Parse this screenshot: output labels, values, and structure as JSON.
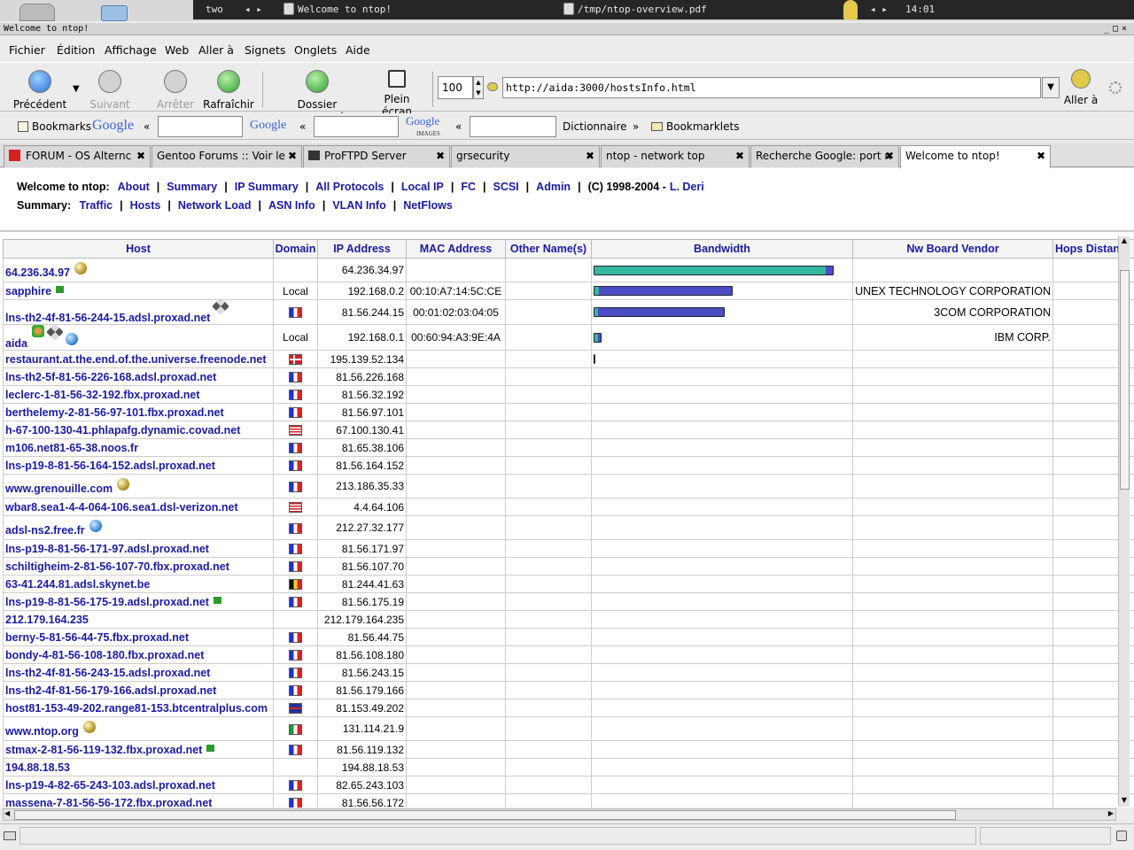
{
  "taskbar": {
    "desktop": "two",
    "arrows": "◂  ▸",
    "task1": "Welcome to ntop!",
    "task2": "/tmp/ntop-overview.pdf",
    "clock_arrows": "◂  ▸",
    "clock": "14:01"
  },
  "window": {
    "title": "Welcome to ntop!",
    "buttons": "_□×"
  },
  "menu": [
    "Fichier",
    "Édition",
    "Affichage",
    "Web",
    "Aller à",
    "Signets",
    "Onglets",
    "Aide"
  ],
  "toolbar": {
    "back": "Précédent",
    "forward": "Suivant",
    "stop": "Arrêter",
    "reload": "Rafraîchir",
    "home": "Dossier personnel",
    "fullscreen": "Plein écran",
    "zoom": "100",
    "url": "http://aida:3000/hostsInfo.html",
    "go": "Aller à"
  },
  "bookmarks_bar": {
    "bookmarks": "Bookmarks",
    "google": "Google",
    "google2": "Google",
    "google_images": "Google",
    "images_sub": "IMAGES",
    "quote": "«",
    "dictionary": "Dictionnaire",
    "dict_sep": "»",
    "bookmarklets": "Bookmarklets"
  },
  "tabs": [
    {
      "label": "FORUM - OS Alternc",
      "close": "✖"
    },
    {
      "label": "Gentoo Forums :: Voir le",
      "close": "✖"
    },
    {
      "label": "ProFTPD Server",
      "close": "✖"
    },
    {
      "label": "grsecurity",
      "close": "✖"
    },
    {
      "label": "ntop - network top",
      "close": "✖"
    },
    {
      "label": "Recherche Google: port n",
      "close": "✖"
    },
    {
      "label": "Welcome to ntop!",
      "close": "✖"
    }
  ],
  "pagenav": {
    "welcome": "Welcome to ntop:",
    "links1": [
      "About",
      "Summary",
      "IP Summary",
      "All Protocols",
      "Local IP",
      "FC",
      "SCSI",
      "Admin"
    ],
    "copyright": "(C) 1998-2004 -",
    "author": "L. Deri",
    "summary": "Summary:",
    "links2": [
      "Traffic",
      "Hosts",
      "Network Load",
      "ASN Info",
      "VLAN Info",
      "NetFlows"
    ]
  },
  "table": {
    "headers": [
      "Host",
      "Domain",
      "IP Address",
      "MAC Address",
      "Other Name(s)",
      "Bandwidth",
      "Nw Board Vendor",
      "Hops Distan"
    ],
    "rows": [
      {
        "host": "64.236.34.97",
        "domain": "",
        "ip": "64.236.34.97",
        "mac": "",
        "vendor": "",
        "bw": 0.95,
        "icon": "gold",
        "tall": true
      },
      {
        "host": "sapphire",
        "domain": "Local",
        "ip": "192.168.0.2",
        "mac": "00:10:A7:14:5C:CE",
        "vendor": "UNEX TECHNOLOGY CORPORATION",
        "bw": 0.55,
        "icon": "flag"
      },
      {
        "host": "lns-th2-4f-81-56-244-15.adsl.proxad.net",
        "domain": "fr",
        "ip": "81.56.244.15",
        "mac": "00:01:02:03:04:05",
        "vendor": "3COM CORPORATION",
        "bw": 0.52,
        "icon": "arrows",
        "tall": true
      },
      {
        "host": "aida",
        "domain": "Local",
        "ip": "192.168.0.1",
        "mac": "00:60:94:A3:9E:4A",
        "vendor": "IBM CORP.",
        "bw": 0.03,
        "icon": "multi",
        "tall": true
      },
      {
        "host": "restaurant.at.the.end.of.the.universe.freenode.net",
        "domain": "no",
        "ip": "195.139.52.134",
        "mac": "",
        "vendor": "",
        "bw": 0.01
      },
      {
        "host": "lns-th2-5f-81-56-226-168.adsl.proxad.net",
        "domain": "fr",
        "ip": "81.56.226.168",
        "mac": "",
        "vendor": "",
        "bw": 0
      },
      {
        "host": "leclerc-1-81-56-32-192.fbx.proxad.net",
        "domain": "fr",
        "ip": "81.56.32.192",
        "mac": "",
        "vendor": "",
        "bw": 0
      },
      {
        "host": "berthelemy-2-81-56-97-101.fbx.proxad.net",
        "domain": "fr",
        "ip": "81.56.97.101",
        "mac": "",
        "vendor": "",
        "bw": 0
      },
      {
        "host": "h-67-100-130-41.phlapafg.dynamic.covad.net",
        "domain": "us",
        "ip": "67.100.130.41",
        "mac": "",
        "vendor": "",
        "bw": 0
      },
      {
        "host": "m106.net81-65-38.noos.fr",
        "domain": "fr",
        "ip": "81.65.38.106",
        "mac": "",
        "vendor": "",
        "bw": 0
      },
      {
        "host": "lns-p19-8-81-56-164-152.adsl.proxad.net",
        "domain": "fr",
        "ip": "81.56.164.152",
        "mac": "",
        "vendor": "",
        "bw": 0
      },
      {
        "host": "www.grenouille.com",
        "domain": "fr",
        "ip": "213.186.35.33",
        "mac": "",
        "vendor": "",
        "bw": 0,
        "icon": "gold",
        "tall": true
      },
      {
        "host": "wbar8.sea1-4-4-064-106.sea1.dsl-verizon.net",
        "domain": "us",
        "ip": "4.4.64.106",
        "mac": "",
        "vendor": "",
        "bw": 0
      },
      {
        "host": "adsl-ns2.free.fr",
        "domain": "fr",
        "ip": "212.27.32.177",
        "mac": "",
        "vendor": "",
        "bw": 0,
        "icon": "globe",
        "tall": true
      },
      {
        "host": "lns-p19-8-81-56-171-97.adsl.proxad.net",
        "domain": "fr",
        "ip": "81.56.171.97",
        "mac": "",
        "vendor": "",
        "bw": 0
      },
      {
        "host": "schiltigheim-2-81-56-107-70.fbx.proxad.net",
        "domain": "fr",
        "ip": "81.56.107.70",
        "mac": "",
        "vendor": "",
        "bw": 0
      },
      {
        "host": "63-41.244.81.adsl.skynet.be",
        "domain": "be",
        "ip": "81.244.41.63",
        "mac": "",
        "vendor": "",
        "bw": 0
      },
      {
        "host": "lns-p19-8-81-56-175-19.adsl.proxad.net",
        "domain": "fr",
        "ip": "81.56.175.19",
        "mac": "",
        "vendor": "",
        "bw": 0,
        "icon": "flag"
      },
      {
        "host": "212.179.164.235",
        "domain": "",
        "ip": "212.179.164.235",
        "mac": "",
        "vendor": "",
        "bw": 0
      },
      {
        "host": "berny-5-81-56-44-75.fbx.proxad.net",
        "domain": "fr",
        "ip": "81.56.44.75",
        "mac": "",
        "vendor": "",
        "bw": 0
      },
      {
        "host": "bondy-4-81-56-108-180.fbx.proxad.net",
        "domain": "fr",
        "ip": "81.56.108.180",
        "mac": "",
        "vendor": "",
        "bw": 0
      },
      {
        "host": "lns-th2-4f-81-56-243-15.adsl.proxad.net",
        "domain": "fr",
        "ip": "81.56.243.15",
        "mac": "",
        "vendor": "",
        "bw": 0
      },
      {
        "host": "lns-th2-4f-81-56-179-166.adsl.proxad.net",
        "domain": "fr",
        "ip": "81.56.179.166",
        "mac": "",
        "vendor": "",
        "bw": 0
      },
      {
        "host": "host81-153-49-202.range81-153.btcentralplus.com",
        "domain": "uk",
        "ip": "81.153.49.202",
        "mac": "",
        "vendor": "",
        "bw": 0
      },
      {
        "host": "www.ntop.org",
        "domain": "it",
        "ip": "131.114.21.9",
        "mac": "",
        "vendor": "",
        "bw": 0,
        "icon": "gold",
        "tall": true
      },
      {
        "host": "stmax-2-81-56-119-132.fbx.proxad.net",
        "domain": "fr",
        "ip": "81.56.119.132",
        "mac": "",
        "vendor": "",
        "bw": 0,
        "icon": "flag"
      },
      {
        "host": "194.88.18.53",
        "domain": "",
        "ip": "194.88.18.53",
        "mac": "",
        "vendor": "",
        "bw": 0
      },
      {
        "host": "lns-p19-4-82-65-243-103.adsl.proxad.net",
        "domain": "fr",
        "ip": "82.65.243.103",
        "mac": "",
        "vendor": "",
        "bw": 0
      },
      {
        "host": "massena-7-81-56-56-172.fbx.proxad.net",
        "domain": "fr",
        "ip": "81.56.56.172",
        "mac": "",
        "vendor": "",
        "bw": 0
      }
    ]
  },
  "colors": {
    "link": "#1a1aa6",
    "bar_blue": "#4b4bc4",
    "bar_green": "#35b8a0"
  }
}
